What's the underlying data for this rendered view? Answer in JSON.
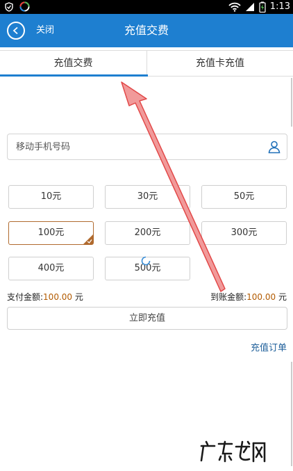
{
  "status_bar": {
    "time": "1:13"
  },
  "header": {
    "close_label": "关闭",
    "title": "充值交费"
  },
  "tabs": [
    {
      "label": "充值交费",
      "active": true
    },
    {
      "label": "充值卡充值",
      "active": false
    }
  ],
  "phone": {
    "placeholder": "移动手机号码",
    "value": ""
  },
  "amounts": [
    {
      "label": "10元",
      "selected": false
    },
    {
      "label": "30元",
      "selected": false
    },
    {
      "label": "50元",
      "selected": false
    },
    {
      "label": "100元",
      "selected": true
    },
    {
      "label": "200元",
      "selected": false
    },
    {
      "label": "300元",
      "selected": false
    },
    {
      "label": "400元",
      "selected": false
    },
    {
      "label": "500元",
      "selected": false
    }
  ],
  "summary": {
    "pay_label": "支付金额:",
    "pay_value": "100.00",
    "pay_unit": "元",
    "arrive_label": "到账金额:",
    "arrive_value": "100.00",
    "arrive_unit": "元"
  },
  "submit_label": "立即充值",
  "orders_label": "充值订单",
  "colors": {
    "accent": "#1e7fd0",
    "selected_border": "#b06a2e",
    "amount_value": "#b25a00",
    "link": "#1e5f9a",
    "arrow": "#e85050"
  }
}
